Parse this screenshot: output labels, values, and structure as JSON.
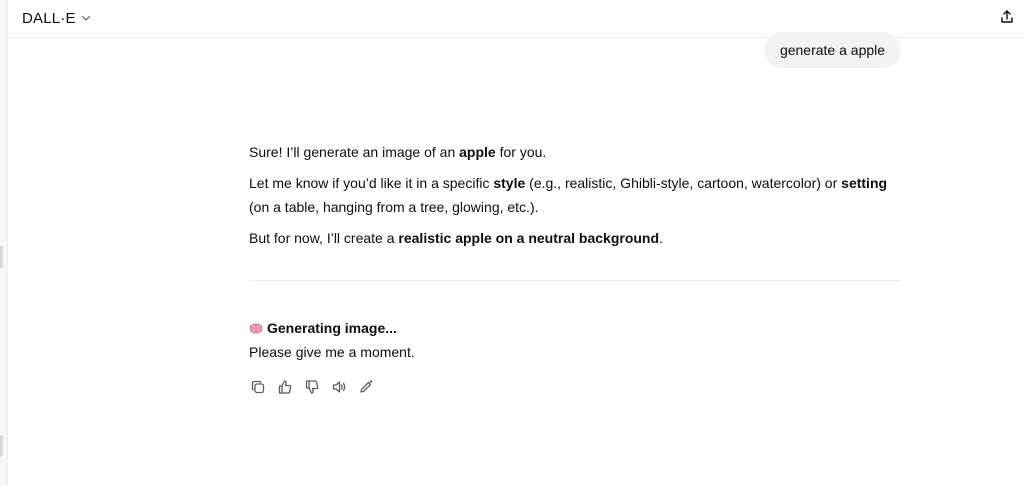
{
  "header": {
    "model_name": "DALL·E",
    "chevron_icon": "chevron-down-icon",
    "share_icon": "share-upload-icon"
  },
  "conversation": {
    "user_message": "generate a apple",
    "assistant": {
      "p1": {
        "t1": "Sure! I’ll generate an image of an ",
        "b1": "apple",
        "t2": " for you."
      },
      "p2": {
        "t1": "Let me know if you’d like it in a specific ",
        "b1": "style",
        "t2": " (e.g., realistic, Ghibli-style, cartoon, watercolor) or ",
        "b2": "setting",
        "t3": " (on a table, hanging from a tree, glowing, etc.)."
      },
      "p3": {
        "t1": "But for now, I’ll create a ",
        "b1": "realistic apple on a neutral background",
        "t2": "."
      }
    },
    "generating": {
      "title": "Generating image...",
      "subtitle": "Please give me a moment.",
      "icon": "brain-icon"
    },
    "actions": [
      {
        "name": "copy-button",
        "icon": "copy-icon"
      },
      {
        "name": "thumbs-up-button",
        "icon": "thumbs-up-icon"
      },
      {
        "name": "thumbs-down-button",
        "icon": "thumbs-down-icon"
      },
      {
        "name": "read-aloud-button",
        "icon": "speaker-icon"
      },
      {
        "name": "edit-image-button",
        "icon": "pencil-sparkle-icon"
      }
    ]
  },
  "colors": {
    "text": "#0d0d0d",
    "bubble_bg": "#f3f3f3",
    "icon": "#5d5d5d",
    "brain": "#e88ab2"
  }
}
